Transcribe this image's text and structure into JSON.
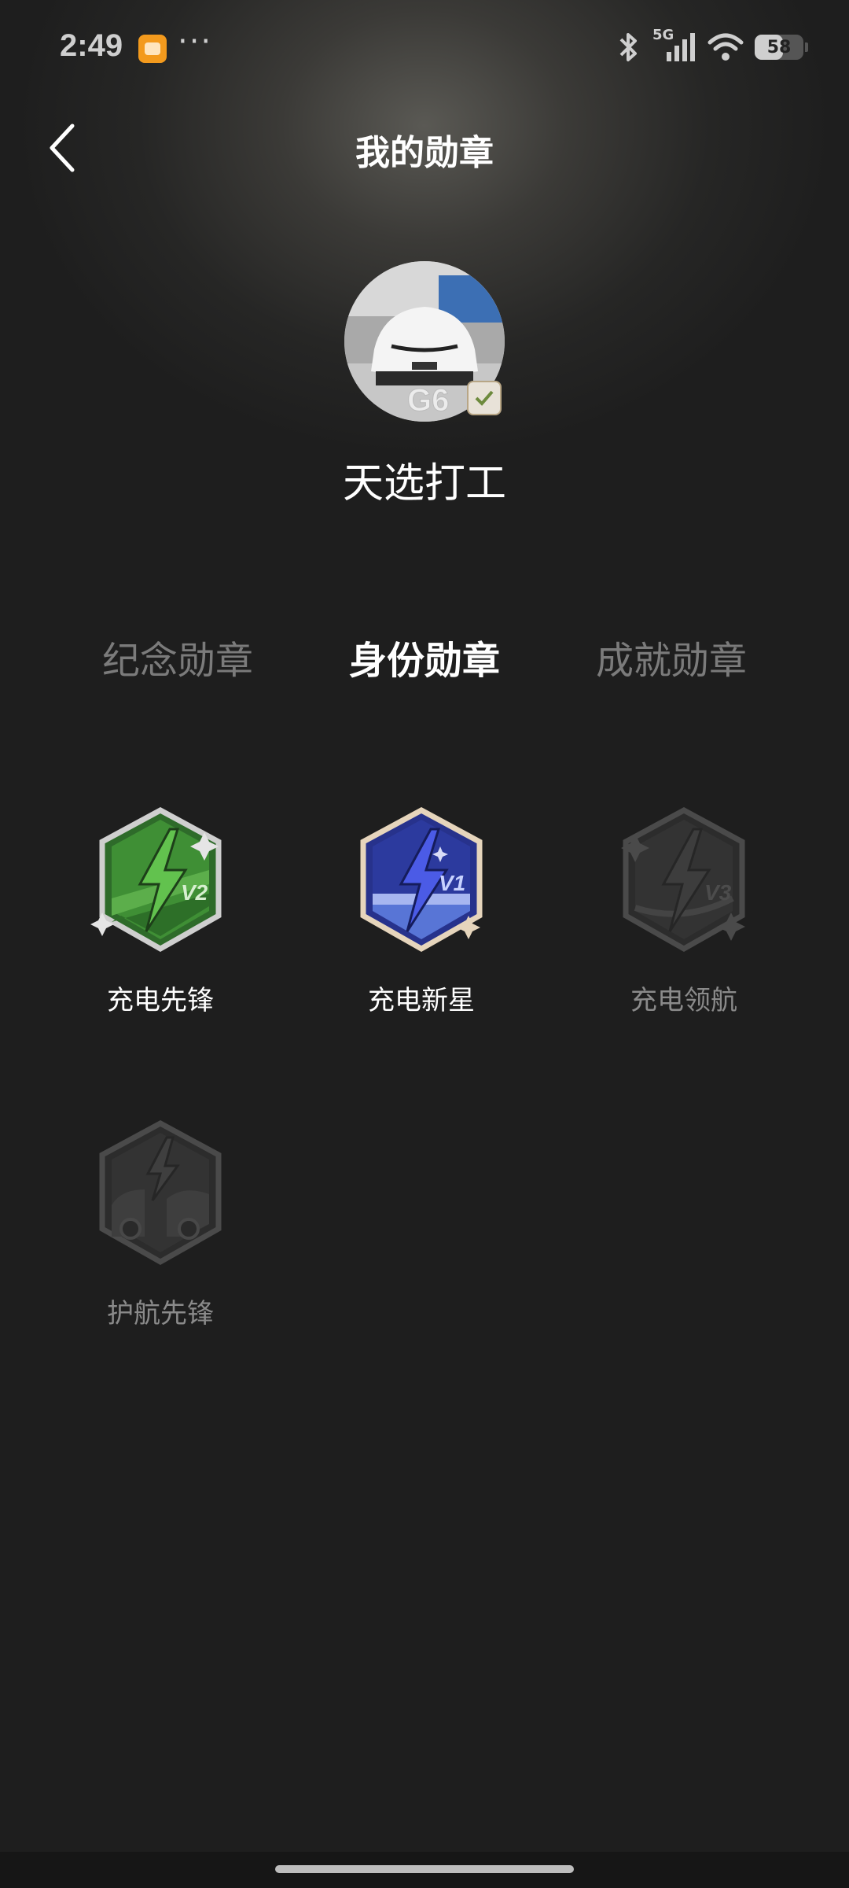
{
  "status_bar": {
    "time": "2:49",
    "dots": "···",
    "network": "5G",
    "battery_level": "58",
    "battery_fraction": 0.58
  },
  "header": {
    "title": "我的勋章"
  },
  "profile": {
    "username": "天选打工",
    "avatar_plate_text": "G6"
  },
  "tabs": [
    {
      "label": "纪念勋章",
      "active": false
    },
    {
      "label": "身份勋章",
      "active": true
    },
    {
      "label": "成就勋章",
      "active": false
    }
  ],
  "badges": [
    {
      "label": "充电先锋",
      "level": "V2",
      "unlocked": true,
      "color": "#4a9a3c"
    },
    {
      "label": "充电新星",
      "level": "V1",
      "unlocked": true,
      "color": "#3f4fc2"
    },
    {
      "label": "充电领航",
      "level": "V3",
      "unlocked": false,
      "color": "#3a3a3a"
    },
    {
      "label": "护航先锋",
      "level": "",
      "unlocked": false,
      "color": "#3a3a3a"
    }
  ],
  "colors": {
    "background": "#1e1e1e",
    "text_primary": "#ffffff",
    "text_inactive": "#7b7b7b"
  }
}
